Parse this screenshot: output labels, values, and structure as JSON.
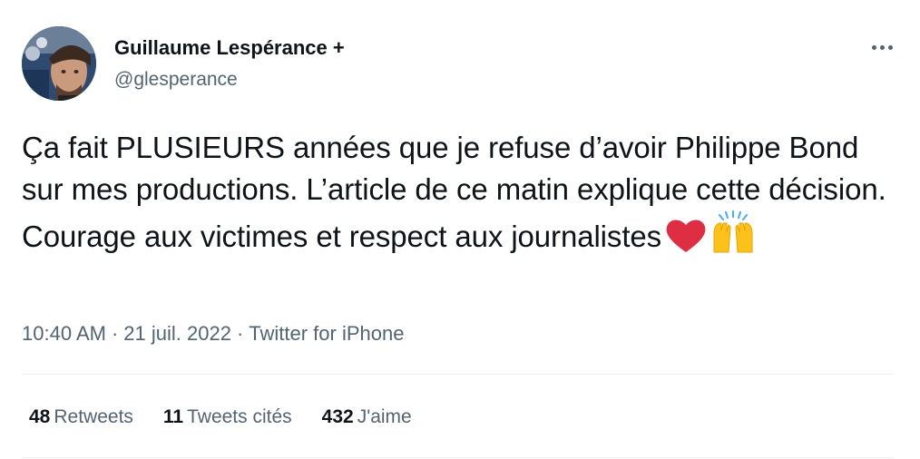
{
  "author": {
    "display_name": "Guillaume Lespérance +",
    "handle": "@glesperance"
  },
  "tweet": {
    "text": "Ça fait PLUSIEURS années que je refuse d’avoir Philippe Bond sur mes productions. L’article de ce matin explique cette décision. Courage aux victimes et respect aux journalistes",
    "emojis": [
      "red-heart",
      "raising-hands"
    ]
  },
  "meta": {
    "time": "10:40 AM",
    "separator": "·",
    "date": "21 juil. 2022",
    "source": "Twitter for iPhone"
  },
  "stats": {
    "retweets": {
      "count": "48",
      "label": "Retweets"
    },
    "quotes": {
      "count": "11",
      "label": "Tweets cités"
    },
    "likes": {
      "count": "432",
      "label": "J'aime"
    }
  },
  "colors": {
    "text_primary": "#0f1419",
    "text_secondary": "#536471",
    "divider": "#eff3f4",
    "heart": "#dd2e44",
    "hands": "#fcc21b"
  },
  "icons": {
    "more": "more-horizontal-icon"
  }
}
